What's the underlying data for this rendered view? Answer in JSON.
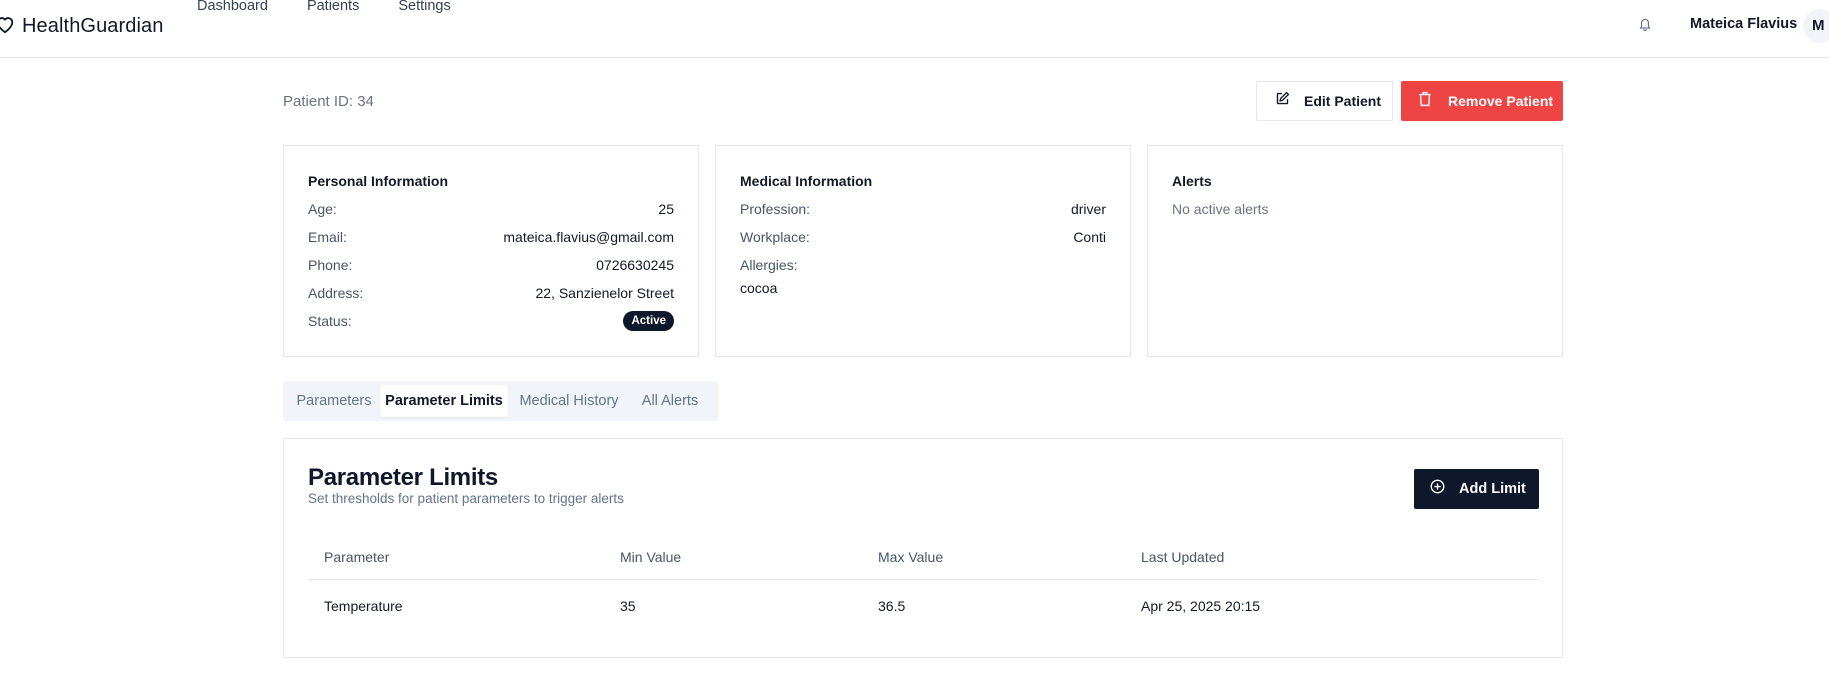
{
  "app": {
    "name": "HealthGuardian"
  },
  "nav": {
    "dashboard": "Dashboard",
    "patients": "Patients",
    "settings": "Settings"
  },
  "user": {
    "name": "Mateica Flavius",
    "initial": "M"
  },
  "patient": {
    "id_label": "Patient ID: 34"
  },
  "actions": {
    "edit": "Edit Patient",
    "remove": "Remove Patient",
    "remove_color": "#ef4444"
  },
  "personal": {
    "title": "Personal Information",
    "age_label": "Age:",
    "age": "25",
    "email_label": "Email:",
    "email": "mateica.flavius@gmail.com",
    "phone_label": "Phone:",
    "phone": "0726630245",
    "address_label": "Address:",
    "address": "22, Sanzienelor Street",
    "status_label": "Status:",
    "status": "Active"
  },
  "medical": {
    "title": "Medical Information",
    "profession_label": "Profession:",
    "profession": "driver",
    "workplace_label": "Workplace:",
    "workplace": "Conti",
    "allergies_label": "Allergies:",
    "allergies": "cocoa"
  },
  "alerts": {
    "title": "Alerts",
    "empty": "No active alerts"
  },
  "tabs": [
    "Parameters",
    "Parameter Limits",
    "Medical History",
    "All Alerts"
  ],
  "active_tab": "Parameter Limits",
  "limits": {
    "title": "Parameter Limits",
    "subtitle": "Set thresholds for patient parameters to trigger alerts",
    "add_label": "Add Limit",
    "columns": [
      "Parameter",
      "Min Value",
      "Max Value",
      "Last Updated"
    ],
    "rows": [
      [
        "Temperature",
        "35",
        "36.5",
        "Apr 25, 2025 20:15"
      ]
    ]
  },
  "colors": {
    "primary": "#0f172a",
    "danger": "#ef4444",
    "border": "#e5e7eb"
  }
}
